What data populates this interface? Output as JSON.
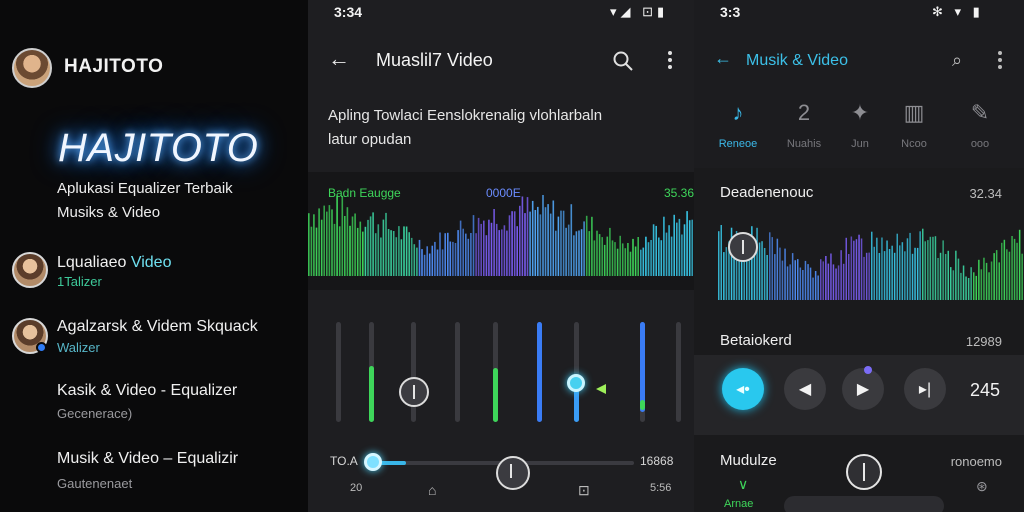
{
  "left": {
    "header_name": "HAJITOTO",
    "brand": "HAJITOTO",
    "tagline_line1": "Aplukasi Equalizer Terbaik",
    "tagline_line2": "Musiks & Video",
    "items": [
      {
        "title_a": "Lqualiaeo ",
        "title_b": "Video",
        "sub": "1Talizer"
      },
      {
        "title_a": "Agalzarsk & Videm Skquack",
        "title_b": "",
        "sub": "Walizer"
      },
      {
        "title_a": "Kasik & Video - Equalizer",
        "title_b": "",
        "sub": "Gecenerace)"
      },
      {
        "title_a": "Musik & Video – Equalizir",
        "title_b": "",
        "sub": "Gautenenaet"
      }
    ]
  },
  "middle": {
    "time": "3:34",
    "status_icons": "▾◢ ⊡▮",
    "title": "Muaslil7 Video",
    "description": "Apling Towlaci Eenslokrenalig vlohlarbaln latur opudan",
    "wave_left_label": "Badn Eaugge",
    "wave_mid_label": "0000E",
    "wave_right_label": "35.36",
    "bottom_left": "TO.A",
    "bottom_right": "16868",
    "small_left": "20",
    "small_right": "5:56",
    "icons": {
      "back": "back-arrow-icon",
      "search": "search-icon",
      "menu": "more-vertical-icon"
    }
  },
  "right": {
    "time": "3:3",
    "status_icons": "✻ ▾ ▮",
    "title": "Musik & Video",
    "tabs": [
      {
        "icon": "♪",
        "label": "Reneoe",
        "active": true
      },
      {
        "icon": "2",
        "label": "Nuahis",
        "active": false
      },
      {
        "icon": "✦",
        "label": "Jun",
        "active": false
      },
      {
        "icon": "▥",
        "label": "Ncoo",
        "active": false
      },
      {
        "icon": "✎",
        "label": "ooo",
        "active": false
      }
    ],
    "sec1_title": "Deadenenouc",
    "sec1_value": "32.34",
    "sec2_title": "Betaiokerd",
    "sec2_value": "12989",
    "player_count": "245",
    "sec3_title": "Mudulze",
    "sec3_value": "ronoemo",
    "sec3_sub": "Arnae"
  },
  "colors": {
    "accent_cyan": "#29c8ee",
    "accent_green": "#3ed65a",
    "accent_blue": "#3a7cf5",
    "accent_purple": "#7b6cf6"
  }
}
